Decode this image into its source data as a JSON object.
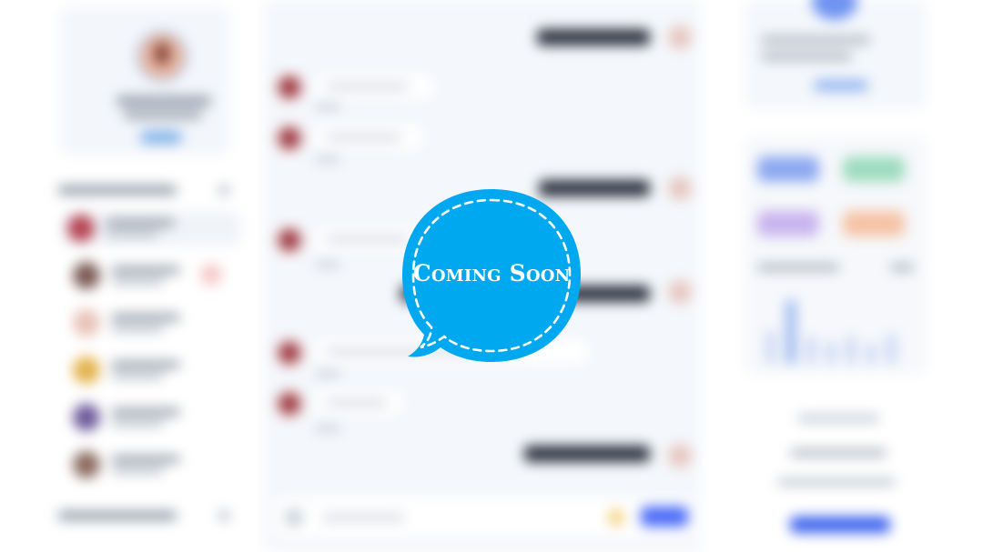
{
  "overlay": {
    "text": "Coming Soon",
    "color": "#00a8f0"
  },
  "left_sidebar": {
    "profile": {
      "avatar_color": "#e9b7a4",
      "status_color": "#7fb1e8"
    },
    "contacts": [
      {
        "avatar_color": "#b64452",
        "active": true,
        "has_badge": false
      },
      {
        "avatar_color": "#7a5a54",
        "active": false,
        "has_badge": true,
        "badge_color": "#f4c9c8"
      },
      {
        "avatar_color": "#e8c2b8",
        "active": false,
        "has_badge": false
      },
      {
        "avatar_color": "#e3b24a",
        "active": false,
        "has_badge": false
      },
      {
        "avatar_color": "#6b5a9a",
        "active": false,
        "has_badge": false
      },
      {
        "avatar_color": "#8a6a60",
        "active": false,
        "has_badge": false
      }
    ]
  },
  "chat": {
    "messages": [
      {
        "direction": "out"
      },
      {
        "direction": "in"
      },
      {
        "direction": "in"
      },
      {
        "direction": "out"
      },
      {
        "direction": "in"
      },
      {
        "direction": "out"
      },
      {
        "direction": "in"
      },
      {
        "direction": "in"
      },
      {
        "direction": "out"
      }
    ],
    "composer": {
      "send_color": "#4a6cf7",
      "emoji_color": "#f3d27a"
    }
  },
  "right_panel": {
    "stat_chips": [
      {
        "color": "#8da9f1"
      },
      {
        "color": "#9edcbf"
      },
      {
        "color": "#c9b4ef"
      },
      {
        "color": "#f6c3a5"
      }
    ],
    "cta_color": "#3d63ee"
  }
}
